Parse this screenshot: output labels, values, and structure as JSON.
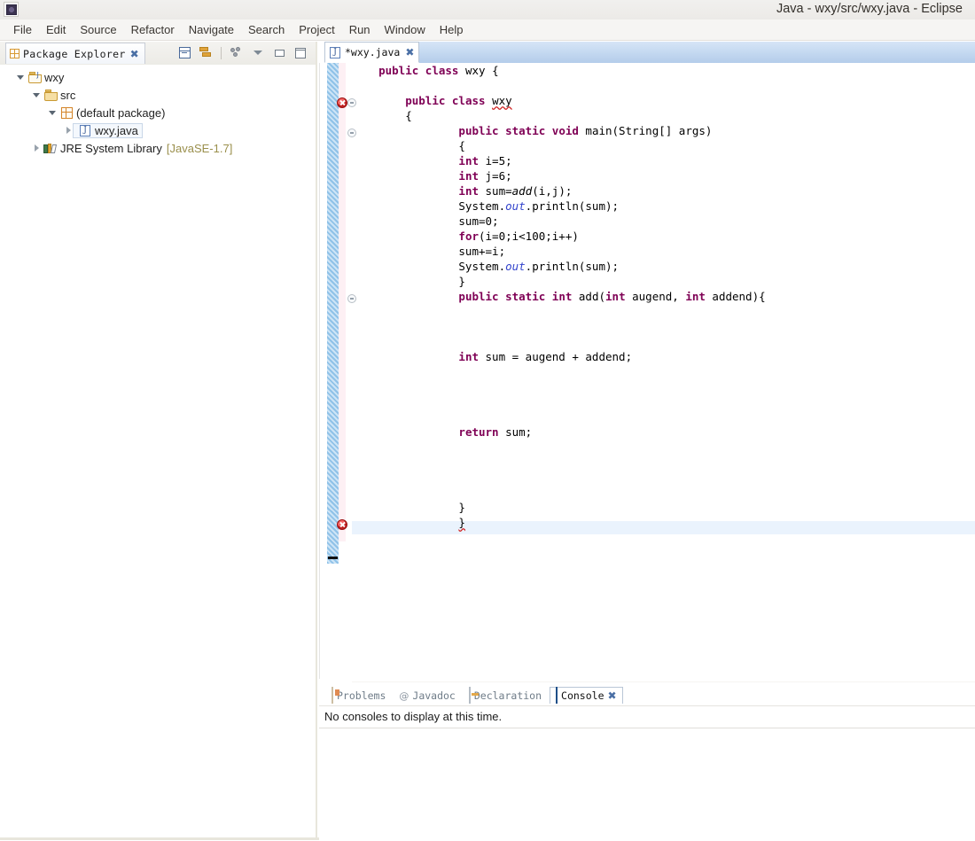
{
  "window": {
    "title": "Java - wxy/src/wxy.java - Eclipse",
    "app_icon": "eclipse-icon"
  },
  "menubar": {
    "items": [
      {
        "label": "File",
        "name": "menu-file"
      },
      {
        "label": "Edit",
        "name": "menu-edit"
      },
      {
        "label": "Source",
        "name": "menu-source"
      },
      {
        "label": "Refactor",
        "name": "menu-refactor"
      },
      {
        "label": "Navigate",
        "name": "menu-navigate"
      },
      {
        "label": "Search",
        "name": "menu-search"
      },
      {
        "label": "Project",
        "name": "menu-project"
      },
      {
        "label": "Run",
        "name": "menu-run"
      },
      {
        "label": "Window",
        "name": "menu-window"
      },
      {
        "label": "Help",
        "name": "menu-help"
      }
    ]
  },
  "explorer": {
    "tab_label": "Package Explorer",
    "tools": [
      {
        "name": "collapse-all-icon",
        "title": "Collapse All"
      },
      {
        "name": "link-with-editor-icon",
        "title": "Link with Editor"
      },
      {
        "name": "view-filters-icon",
        "title": "View Filters"
      },
      {
        "name": "view-menu-icon",
        "title": "View Menu"
      },
      {
        "name": "minimize-icon",
        "title": "Minimize"
      },
      {
        "name": "maximize-icon",
        "title": "Maximize"
      }
    ],
    "tree": [
      {
        "label": "wxy",
        "icon": "java-project-icon",
        "twisty": "open",
        "indent": 0,
        "selected": false,
        "suffix": ""
      },
      {
        "label": "src",
        "icon": "source-folder-icon",
        "twisty": "open",
        "indent": 1,
        "selected": false,
        "suffix": ""
      },
      {
        "label": "(default package)",
        "icon": "package-icon",
        "twisty": "open",
        "indent": 2,
        "selected": false,
        "suffix": ""
      },
      {
        "label": "wxy.java",
        "icon": "java-file-icon",
        "twisty": "closed",
        "indent": 3,
        "selected": true,
        "suffix": ""
      },
      {
        "label": "JRE System Library",
        "icon": "jre-library-icon",
        "twisty": "closed",
        "indent": 1,
        "selected": false,
        "suffix": "[JavaSE-1.7]"
      }
    ]
  },
  "editor": {
    "tab_label": "*wxy.java",
    "tab_icon": "java-file-icon",
    "dirty": true,
    "code_lines": [
      {
        "indent": 1,
        "tokens": [
          {
            "t": "public",
            "c": "kw"
          },
          {
            "t": " ",
            "c": ""
          },
          {
            "t": "class",
            "c": "kw"
          },
          {
            "t": " wxy {",
            "c": ""
          }
        ]
      },
      {
        "indent": 0,
        "tokens": []
      },
      {
        "indent": 2,
        "tokens": [
          {
            "t": "public",
            "c": "kw"
          },
          {
            "t": " ",
            "c": ""
          },
          {
            "t": "class",
            "c": "kw"
          },
          {
            "t": " ",
            "c": ""
          },
          {
            "t": "wxy",
            "c": "err-squiggle"
          }
        ]
      },
      {
        "indent": 2,
        "tokens": [
          {
            "t": "{",
            "c": ""
          }
        ]
      },
      {
        "indent": 4,
        "tokens": [
          {
            "t": "public",
            "c": "kw"
          },
          {
            "t": " ",
            "c": ""
          },
          {
            "t": "static",
            "c": "kw"
          },
          {
            "t": " ",
            "c": ""
          },
          {
            "t": "void",
            "c": "kw"
          },
          {
            "t": " main(String[] args)",
            "c": ""
          }
        ]
      },
      {
        "indent": 4,
        "tokens": [
          {
            "t": "{",
            "c": ""
          }
        ]
      },
      {
        "indent": 4,
        "tokens": [
          {
            "t": "int",
            "c": "kw"
          },
          {
            "t": " i=5;",
            "c": ""
          }
        ]
      },
      {
        "indent": 4,
        "tokens": [
          {
            "t": "int",
            "c": "kw"
          },
          {
            "t": " j=6;",
            "c": ""
          }
        ]
      },
      {
        "indent": 4,
        "tokens": [
          {
            "t": "int",
            "c": "kw"
          },
          {
            "t": " sum=",
            "c": ""
          },
          {
            "t": "add",
            "c": "mth"
          },
          {
            "t": "(i,j);",
            "c": ""
          }
        ]
      },
      {
        "indent": 4,
        "tokens": [
          {
            "t": "System.",
            "c": ""
          },
          {
            "t": "out",
            "c": "fld"
          },
          {
            "t": ".println(sum);",
            "c": ""
          }
        ]
      },
      {
        "indent": 4,
        "tokens": [
          {
            "t": "sum=0;",
            "c": ""
          }
        ]
      },
      {
        "indent": 4,
        "tokens": [
          {
            "t": "for",
            "c": "kw"
          },
          {
            "t": "(i=0;i<100;i++)",
            "c": ""
          }
        ]
      },
      {
        "indent": 4,
        "tokens": [
          {
            "t": "sum+=i;",
            "c": ""
          }
        ]
      },
      {
        "indent": 4,
        "tokens": [
          {
            "t": "System.",
            "c": ""
          },
          {
            "t": "out",
            "c": "fld"
          },
          {
            "t": ".println(sum);",
            "c": ""
          }
        ]
      },
      {
        "indent": 4,
        "tokens": [
          {
            "t": "}",
            "c": ""
          }
        ]
      },
      {
        "indent": 4,
        "tokens": [
          {
            "t": "public",
            "c": "kw"
          },
          {
            "t": " ",
            "c": ""
          },
          {
            "t": "static",
            "c": "kw"
          },
          {
            "t": " ",
            "c": ""
          },
          {
            "t": "int",
            "c": "kw"
          },
          {
            "t": " add(",
            "c": ""
          },
          {
            "t": "int",
            "c": "kw"
          },
          {
            "t": " augend, ",
            "c": ""
          },
          {
            "t": "int",
            "c": "kw"
          },
          {
            "t": " addend){",
            "c": ""
          }
        ]
      },
      {
        "indent": 0,
        "tokens": []
      },
      {
        "indent": 0,
        "tokens": []
      },
      {
        "indent": 0,
        "tokens": []
      },
      {
        "indent": 4,
        "tokens": [
          {
            "t": "int",
            "c": "kw"
          },
          {
            "t": " sum = augend + addend;",
            "c": ""
          }
        ]
      },
      {
        "indent": 0,
        "tokens": []
      },
      {
        "indent": 0,
        "tokens": []
      },
      {
        "indent": 0,
        "tokens": []
      },
      {
        "indent": 0,
        "tokens": []
      },
      {
        "indent": 4,
        "tokens": [
          {
            "t": "return",
            "c": "kw"
          },
          {
            "t": " sum;",
            "c": ""
          }
        ]
      },
      {
        "indent": 0,
        "tokens": []
      },
      {
        "indent": 0,
        "tokens": []
      },
      {
        "indent": 0,
        "tokens": []
      },
      {
        "indent": 0,
        "tokens": []
      },
      {
        "indent": 4,
        "tokens": [
          {
            "t": "}",
            "c": ""
          }
        ]
      },
      {
        "indent": 4,
        "tokens": [
          {
            "t": "}",
            "c": "err-squiggle"
          }
        ]
      }
    ],
    "error_markers": [
      {
        "line": 2,
        "name": "error-marker"
      },
      {
        "line": 30,
        "name": "error-marker"
      }
    ],
    "fold_markers": [
      2,
      4,
      15
    ],
    "scroll_left_arrow": "‹"
  },
  "bottom_panel": {
    "tabs": [
      {
        "label": "Problems",
        "icon": "problems-icon",
        "active": false
      },
      {
        "label": "Javadoc",
        "icon": "javadoc-icon",
        "active": false
      },
      {
        "label": "Declaration",
        "icon": "declaration-icon",
        "active": false
      },
      {
        "label": "Console",
        "icon": "console-icon",
        "active": true
      }
    ],
    "console_message": "No consoles to display at this time."
  },
  "colors": {
    "keyword": "#7f0055",
    "static_field": "#3344cc",
    "error_red": "#c02222",
    "changed_bar": "#8fc2e8",
    "tab_active": "#b4ccea",
    "jre_suffix": "#9a8f4c"
  }
}
